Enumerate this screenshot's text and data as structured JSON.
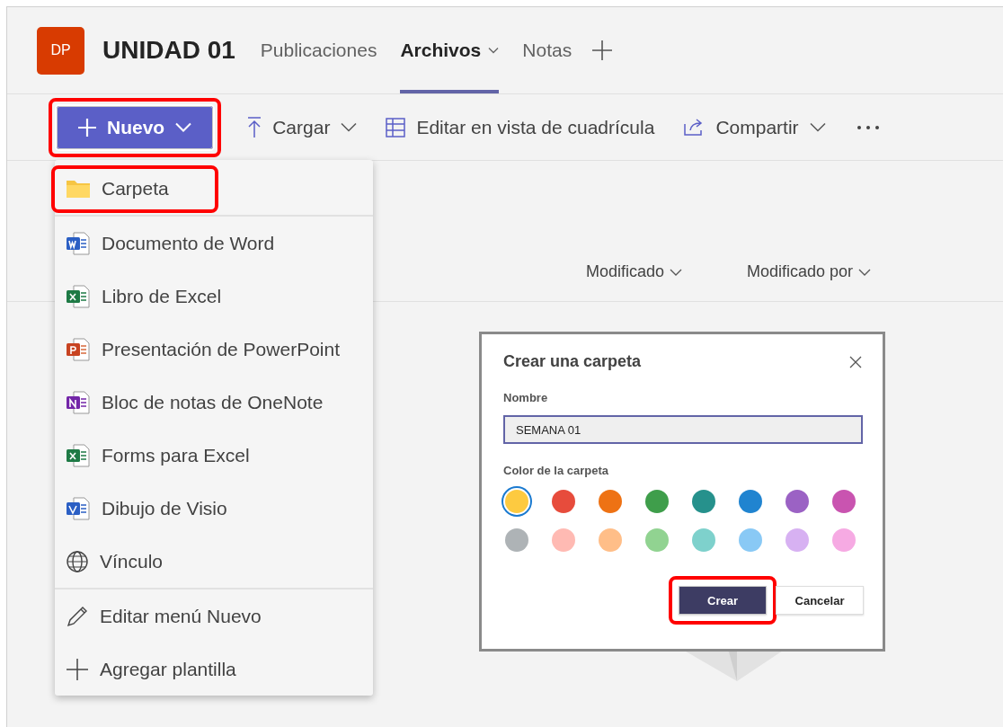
{
  "team": {
    "initials": "DP",
    "name": "UNIDAD 01"
  },
  "tabs": [
    {
      "label": "Publicaciones",
      "selected": false,
      "dropdown": false
    },
    {
      "label": "Archivos",
      "selected": true,
      "dropdown": true
    },
    {
      "label": "Notas",
      "selected": false,
      "dropdown": false
    }
  ],
  "toolbar": {
    "new_button": {
      "label": "Nuevo",
      "highlighted": true
    },
    "items": [
      {
        "kind": "upload",
        "label": "Cargar",
        "dropdown": true
      },
      {
        "kind": "grid",
        "label": "Editar en vista de cuadrícula",
        "dropdown": false
      },
      {
        "kind": "share",
        "label": "Compartir",
        "dropdown": true
      }
    ]
  },
  "columns": [
    {
      "label": "Modificado"
    },
    {
      "label": "Modificado por"
    }
  ],
  "new_menu": {
    "sections": [
      [
        {
          "kind": "folder",
          "label": "Carpeta",
          "highlighted": true
        }
      ],
      [
        {
          "kind": "word",
          "label": "Documento de Word",
          "highlighted": false
        },
        {
          "kind": "excel",
          "label": "Libro de Excel",
          "highlighted": false
        },
        {
          "kind": "powerpoint",
          "label": "Presentación de PowerPoint",
          "highlighted": false
        },
        {
          "kind": "onenote",
          "label": "Bloc de notas de OneNote",
          "highlighted": false
        },
        {
          "kind": "excel",
          "label": "Forms para Excel",
          "highlighted": false
        },
        {
          "kind": "visio",
          "label": "Dibujo de Visio",
          "highlighted": false
        },
        {
          "kind": "link",
          "label": "Vínculo",
          "highlighted": false
        }
      ],
      [
        {
          "kind": "edit",
          "label": "Editar menú Nuevo",
          "highlighted": false
        },
        {
          "kind": "add",
          "label": "Agregar plantilla",
          "highlighted": false
        }
      ]
    ]
  },
  "dialog": {
    "title": "Crear una carpeta",
    "name_label": "Nombre",
    "name_value": "SEMANA 01",
    "color_label": "Color de la carpeta",
    "colors": [
      {
        "color": "#fdca40",
        "selected": true
      },
      {
        "color": "#e74c3c",
        "selected": false
      },
      {
        "color": "#ee7214",
        "selected": false
      },
      {
        "color": "#3f9e4b",
        "selected": false
      },
      {
        "color": "#26918c",
        "selected": false
      },
      {
        "color": "#2084d0",
        "selected": false
      },
      {
        "color": "#9b62c4",
        "selected": false
      },
      {
        "color": "#c954b0",
        "selected": false
      },
      {
        "color": "#aeb3b6",
        "selected": false
      },
      {
        "color": "#ffbab3",
        "selected": false
      },
      {
        "color": "#ffbe88",
        "selected": false
      },
      {
        "color": "#91d391",
        "selected": false
      },
      {
        "color": "#7ed1cc",
        "selected": false
      },
      {
        "color": "#89c9f5",
        "selected": false
      },
      {
        "color": "#d7b1f2",
        "selected": false
      },
      {
        "color": "#f6aae3",
        "selected": false
      }
    ],
    "buttons": [
      {
        "kind": "primary",
        "label": "Crear",
        "highlighted": true
      },
      {
        "kind": "secondary",
        "label": "Cancelar",
        "highlighted": false
      }
    ]
  }
}
